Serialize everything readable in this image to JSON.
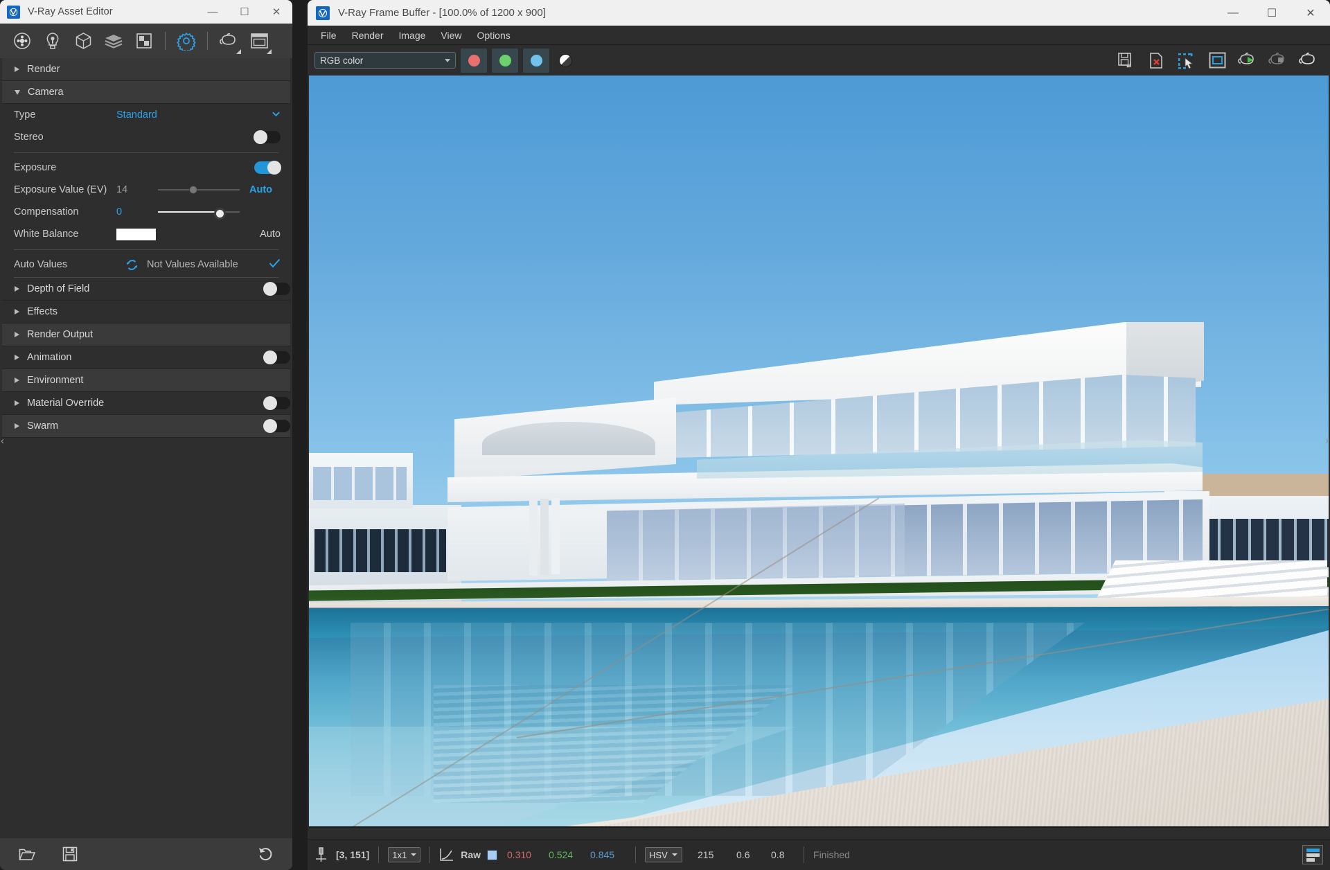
{
  "asset_editor": {
    "title": "V-Ray Asset Editor",
    "window_controls": {
      "minimize": "—",
      "maximize": "☐",
      "close": "✕"
    },
    "toolbar": [
      {
        "name": "materials-icon",
        "tip": "Materials"
      },
      {
        "name": "lights-icon",
        "tip": "Lights"
      },
      {
        "name": "geometry-icon",
        "tip": "Geometry"
      },
      {
        "name": "textures-icon",
        "tip": "Textures"
      },
      {
        "name": "render-elements-icon",
        "tip": "Render Elements"
      },
      {
        "name": "settings-icon",
        "tip": "Settings"
      },
      {
        "name": "render-teapot-icon",
        "tip": "Render"
      },
      {
        "name": "frame-buffer-icon",
        "tip": "Show Frame Buffer"
      }
    ],
    "sections": [
      {
        "label": "Render",
        "expanded": false,
        "toggle": null
      },
      {
        "label": "Camera",
        "expanded": true,
        "toggle": null
      }
    ],
    "camera": {
      "type_label": "Type",
      "type_value": "Standard",
      "stereo_label": "Stereo",
      "stereo_on": false,
      "exposure_label": "Exposure",
      "exposure_on": true,
      "ev_label": "Exposure Value (EV)",
      "ev_value": "14",
      "ev_auto": "Auto",
      "compensation_label": "Compensation",
      "compensation_value": "0",
      "white_balance_label": "White Balance",
      "white_balance_color": "#ffffff",
      "white_balance_auto": "Auto",
      "auto_values_label": "Auto Values",
      "auto_values_status": "Not Values Available"
    },
    "collapsed_sections": [
      {
        "label": "Depth of Field",
        "toggle": "off"
      },
      {
        "label": "Effects",
        "toggle": null
      },
      {
        "label": "Render Output",
        "toggle": null
      },
      {
        "label": "Animation",
        "toggle": "off"
      },
      {
        "label": "Environment",
        "toggle": null
      },
      {
        "label": "Material Override",
        "toggle": "off"
      },
      {
        "label": "Swarm",
        "toggle": "off"
      }
    ],
    "footer": [
      {
        "name": "open-file-icon"
      },
      {
        "name": "save-file-icon"
      },
      {
        "name": "revert-icon"
      }
    ]
  },
  "frame_buffer": {
    "title": "V-Ray Frame Buffer - [100.0% of 1200 x 900]",
    "window_controls": {
      "minimize": "—",
      "maximize": "☐",
      "close": "✕"
    },
    "menu": [
      "File",
      "Render",
      "Image",
      "View",
      "Options"
    ],
    "channel_select": "RGB color",
    "channel_buttons": [
      {
        "name": "red-channel-button",
        "color": "#e8706e"
      },
      {
        "name": "green-channel-button",
        "color": "#6bd16b"
      },
      {
        "name": "blue-channel-button",
        "color": "#72c2ee"
      }
    ],
    "alpha_button": {
      "name": "alpha-channel-button"
    },
    "right_tools": [
      {
        "name": "save-image-icon"
      },
      {
        "name": "clear-image-icon"
      },
      {
        "name": "region-render-icon"
      },
      {
        "name": "show-in-window-icon"
      },
      {
        "name": "start-render-icon"
      },
      {
        "name": "stop-render-icon"
      },
      {
        "name": "render-last-icon"
      }
    ],
    "status": {
      "pixel_coords": "[3, 151]",
      "zoom_ratio": "1x1",
      "curve_label": "Raw",
      "color_chip": "#a8cdf0",
      "r": "0.310",
      "g": "0.524",
      "b": "0.845",
      "color_mode": "HSV",
      "h": "215",
      "s": "0.6",
      "v": "0.8",
      "render_state": "Finished"
    }
  },
  "colors": {
    "accent_blue": "#2aa3e8",
    "panel_bg": "#2e2e2e",
    "toolbar_bg": "#3b3b3b",
    "titlebar_bg": "#f0f0f0",
    "vfb_bg": "#2d2d2d"
  }
}
